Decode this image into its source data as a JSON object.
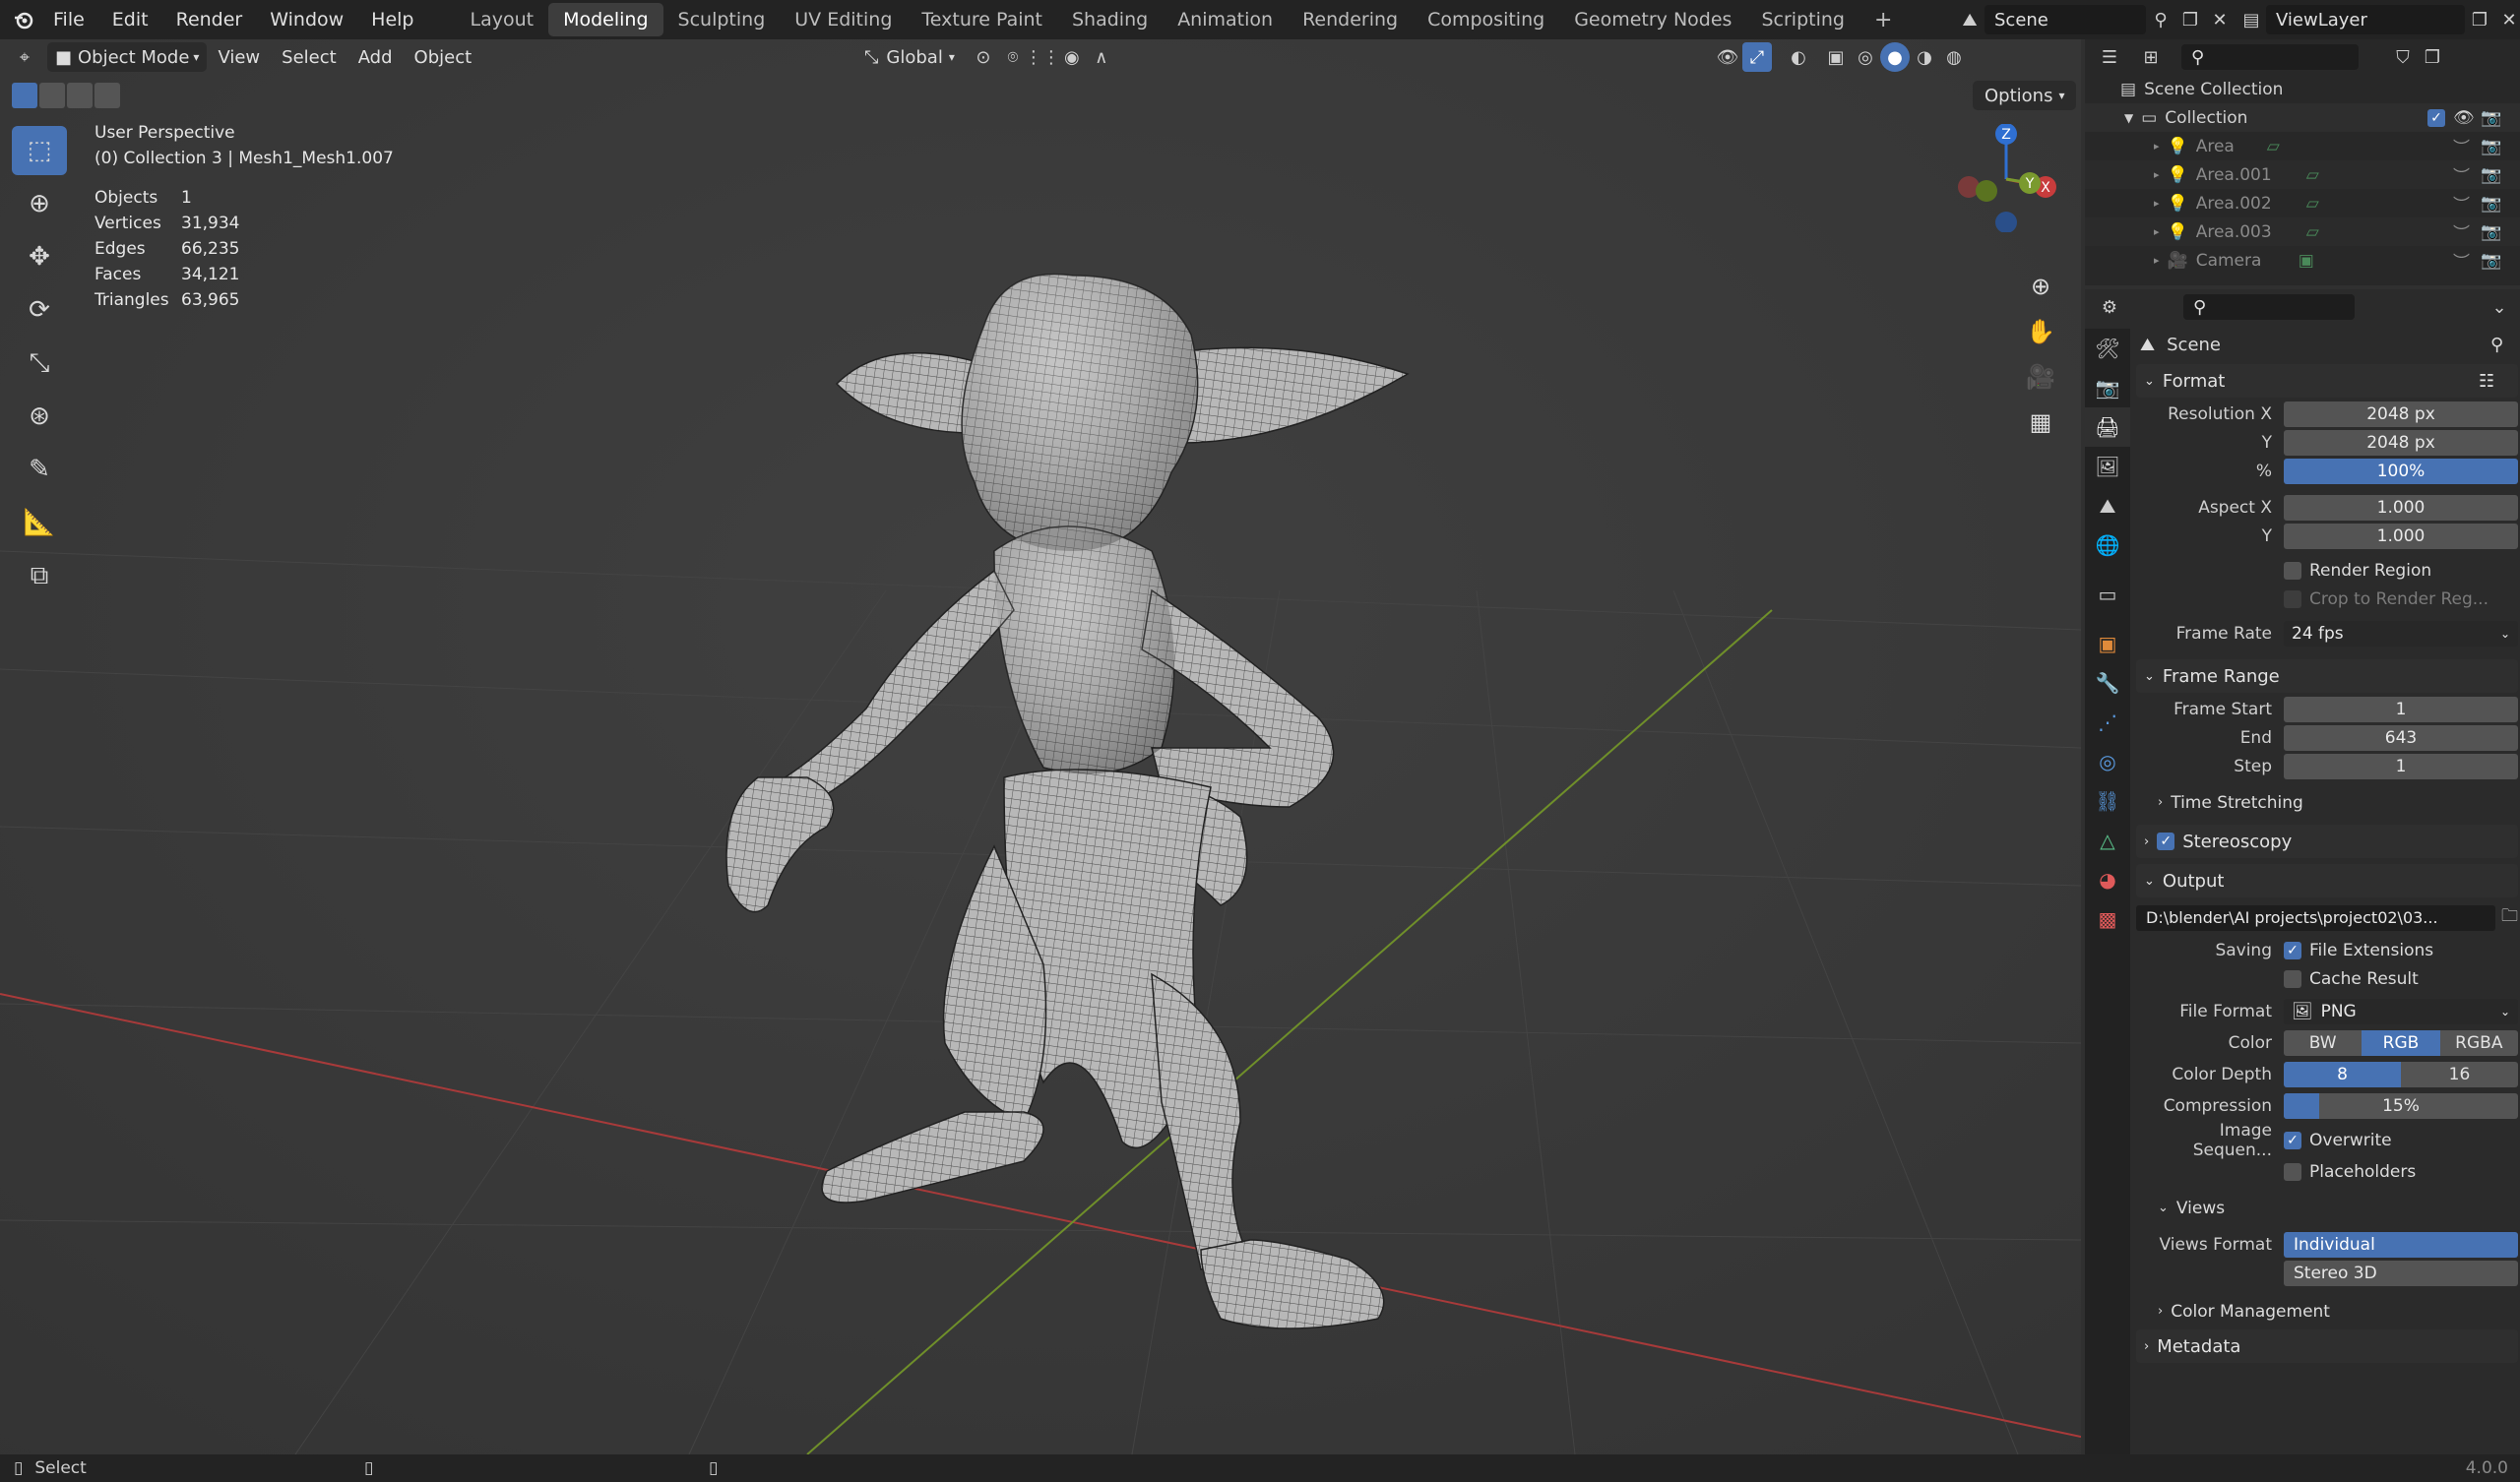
{
  "topbar": {
    "menus": [
      "File",
      "Edit",
      "Render",
      "Window",
      "Help"
    ],
    "workspaces": [
      "Layout",
      "Modeling",
      "Sculpting",
      "UV Editing",
      "Texture Paint",
      "Shading",
      "Animation",
      "Rendering",
      "Compositing",
      "Geometry Nodes",
      "Scripting"
    ],
    "active_workspace": "Modeling",
    "add_tab": "+",
    "scene": "Scene",
    "view_layer": "ViewLayer"
  },
  "viewport_header": {
    "mode": "Object Mode",
    "menus": [
      "View",
      "Select",
      "Add",
      "Object"
    ],
    "orientation": "Global",
    "options": "Options"
  },
  "stats": {
    "view_name": "User Perspective",
    "context": "(0) Collection 3 | Mesh1_Mesh1.007",
    "rows": [
      {
        "label": "Objects",
        "value": "1"
      },
      {
        "label": "Vertices",
        "value": "31,934"
      },
      {
        "label": "Edges",
        "value": "66,235"
      },
      {
        "label": "Faces",
        "value": "34,121"
      },
      {
        "label": "Triangles",
        "value": "63,965"
      }
    ]
  },
  "gizmo": {
    "z": "Z",
    "y": "Y",
    "x": "X"
  },
  "outliner": {
    "root": "Scene Collection",
    "collection": "Collection",
    "items": [
      "Area",
      "Area.001",
      "Area.002",
      "Area.003",
      "Camera"
    ]
  },
  "properties": {
    "context": "Scene",
    "format": {
      "title": "Format",
      "resolution_x_label": "Resolution X",
      "resolution_x": "2048 px",
      "resolution_y_label": "Y",
      "resolution_y": "2048 px",
      "percent_label": "%",
      "percent": "100%",
      "aspect_x_label": "Aspect X",
      "aspect_x": "1.000",
      "aspect_y_label": "Y",
      "aspect_y": "1.000",
      "render_region": "Render Region",
      "crop": "Crop to Render Reg...",
      "frame_rate_label": "Frame Rate",
      "frame_rate": "24 fps"
    },
    "frame_range": {
      "title": "Frame Range",
      "start_label": "Frame Start",
      "start": "1",
      "end_label": "End",
      "end": "643",
      "step_label": "Step",
      "step": "1",
      "time_stretching": "Time Stretching"
    },
    "stereoscopy": "Stereoscopy",
    "output": {
      "title": "Output",
      "path": "D:\\blender\\AI projects\\project02\\03...",
      "saving_label": "Saving",
      "file_extensions": "File Extensions",
      "cache_result": "Cache Result",
      "file_format_label": "File Format",
      "file_format": "PNG",
      "color_label": "Color",
      "color_options": [
        "BW",
        "RGB",
        "RGBA"
      ],
      "color_selected": "RGB",
      "depth_label": "Color Depth",
      "depth_options": [
        "8",
        "16"
      ],
      "depth_selected": "8",
      "compression_label": "Compression",
      "compression": "15%",
      "compression_fraction": 0.15,
      "image_seq_label": "Image Sequen...",
      "overwrite": "Overwrite",
      "placeholders": "Placeholders",
      "views_title": "Views",
      "views_format_label": "Views Format",
      "views_format_options": [
        "Individual",
        "Stereo 3D"
      ],
      "views_selected": "Individual",
      "color_management": "Color Management"
    },
    "metadata": "Metadata"
  },
  "statusbar": {
    "select": "Select",
    "version": "4.0.0"
  },
  "colors": {
    "accent": "#4772b3",
    "x_axis": "#c83c3c",
    "y_axis": "#7a9a2e",
    "z_axis": "#2f6fd1"
  }
}
